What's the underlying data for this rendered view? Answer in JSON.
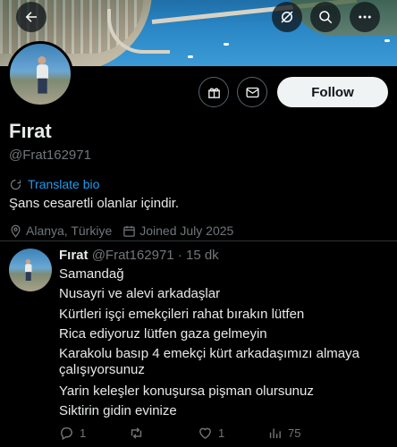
{
  "header": {
    "back_icon": "arrow-left-icon",
    "icons": [
      "no-notifications-icon",
      "search-icon",
      "more-icon"
    ]
  },
  "profile": {
    "name": "Fırat",
    "handle": "@Frat162971",
    "translate_label": "Translate bio",
    "bio": "Şans cesaretli olanlar içindir.",
    "location": "Alanya, Türkiye",
    "joined": "Joined July 2025",
    "follow_label": "Follow"
  },
  "post": {
    "name": "Fırat",
    "handle": "@Frat162971",
    "separator": "·",
    "time": "15 dk",
    "lines": [
      "Samandağ",
      "Nusayri ve alevi arkadaşlar",
      "Kürtleri işçi emekçileri rahat bırakın lütfen",
      "Rica ediyoruz lütfen gaza gelmeyin",
      "Karakolu basıp 4 emekçi kürt arkadaşımızı almaya",
      "çalışıyorsunuz",
      "Yarin keleşler konuşursa pişman olursunuz",
      "Siktirin gidin evinize"
    ],
    "stats": {
      "replies": "1",
      "reposts": "",
      "likes": "1",
      "views": "75"
    }
  },
  "colors": {
    "background": "#000000",
    "text": "#e7e9ea",
    "muted": "#71767b",
    "accent": "#1d9bf0",
    "follow_bg": "#eff3f4"
  }
}
